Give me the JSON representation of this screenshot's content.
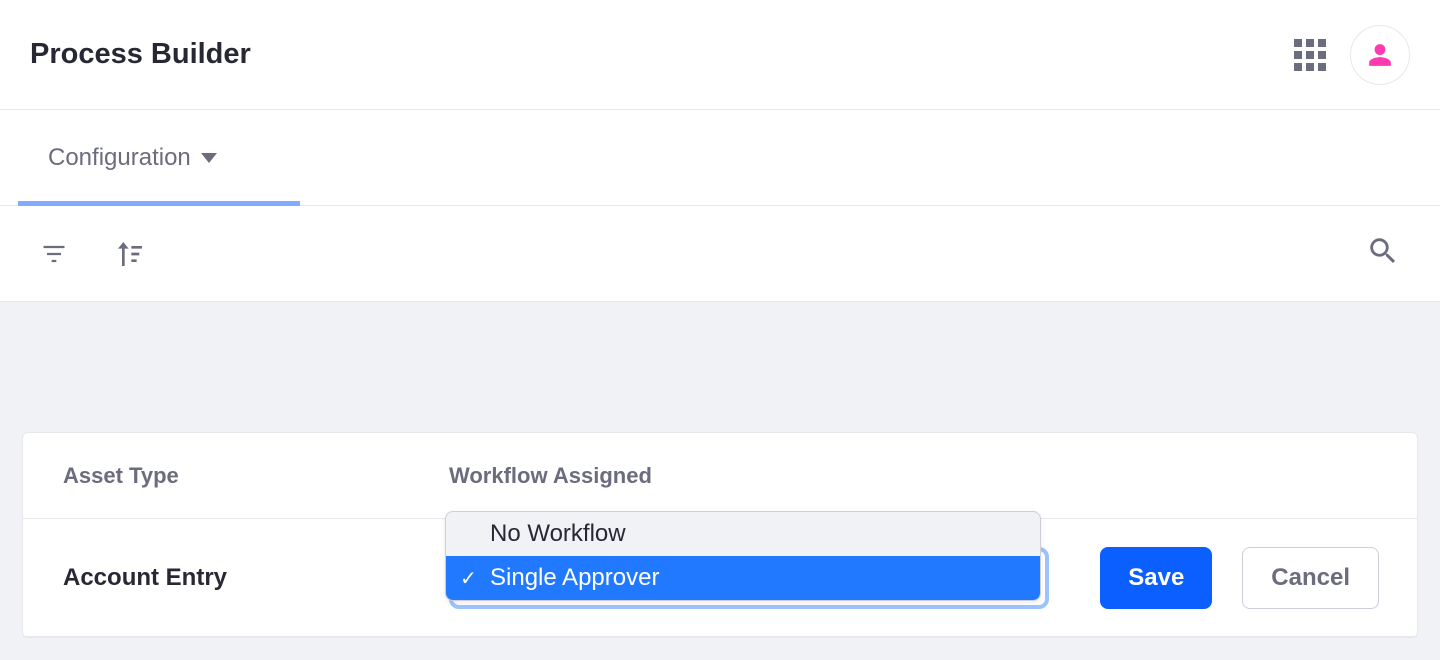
{
  "header": {
    "title": "Process Builder"
  },
  "tabs": {
    "active": "Configuration"
  },
  "table": {
    "columns": {
      "asset_type": "Asset Type",
      "workflow_assigned": "Workflow Assigned"
    },
    "row": {
      "asset_name": "Account Entry"
    }
  },
  "dropdown": {
    "options": [
      "No Workflow",
      "Single Approver"
    ],
    "selected_index": 1
  },
  "actions": {
    "save": "Save",
    "cancel": "Cancel"
  }
}
